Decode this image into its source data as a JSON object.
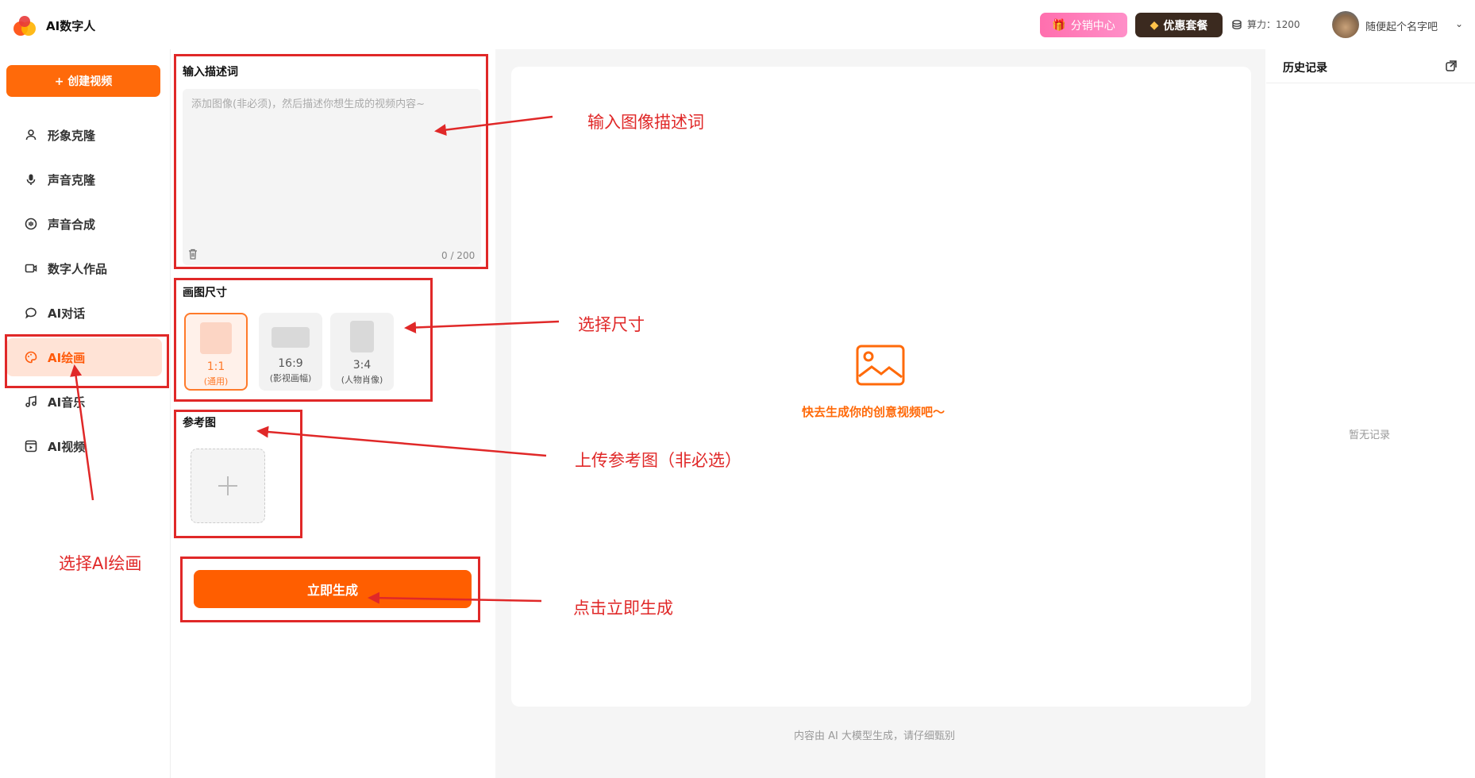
{
  "header": {
    "app_title": "AI数字人",
    "distribution_label": "分销中心",
    "package_label": "优惠套餐",
    "power_label": "算力：1200",
    "username": "随便起个名字吧"
  },
  "sidebar": {
    "create_label": "+ 创建视频",
    "items": [
      {
        "label": "形象克隆",
        "icon": "person-icon"
      },
      {
        "label": "声音克隆",
        "icon": "microphone-icon"
      },
      {
        "label": "声音合成",
        "icon": "waveform-icon"
      },
      {
        "label": "数字人作品",
        "icon": "video-icon"
      },
      {
        "label": "AI对话",
        "icon": "chat-icon"
      },
      {
        "label": "AI绘画",
        "icon": "palette-icon",
        "active": true
      },
      {
        "label": "AI音乐",
        "icon": "music-icon"
      },
      {
        "label": "AI视频",
        "icon": "film-icon"
      }
    ]
  },
  "form": {
    "prompt_title": "输入描述词",
    "prompt_placeholder": "添加图像(非必须)，然后描述你想生成的视频内容~",
    "prompt_count": "0 / 200",
    "size_title": "画图尺寸",
    "sizes": [
      {
        "ratio": "1:1",
        "desc": "(通用)",
        "selected": true
      },
      {
        "ratio": "16:9",
        "desc": "(影视画幅)"
      },
      {
        "ratio": "3:4",
        "desc": "(人物肖像)"
      }
    ],
    "reference_title": "参考图",
    "generate_label": "立即生成"
  },
  "main": {
    "empty_text": "快去生成你的创意视频吧～",
    "footer_note": "内容由 AI 大模型生成，请仔细甄别"
  },
  "history": {
    "title": "历史记录",
    "empty": "暂无记录"
  },
  "annotations": {
    "prompt": "输入图像描述词",
    "size": "选择尺寸",
    "reference": "上传参考图（非必选）",
    "generate": "点击立即生成",
    "select_ai_paint": "选择AI绘画"
  },
  "colors": {
    "accent": "#ff6a0a",
    "annotation": "#e02828"
  }
}
